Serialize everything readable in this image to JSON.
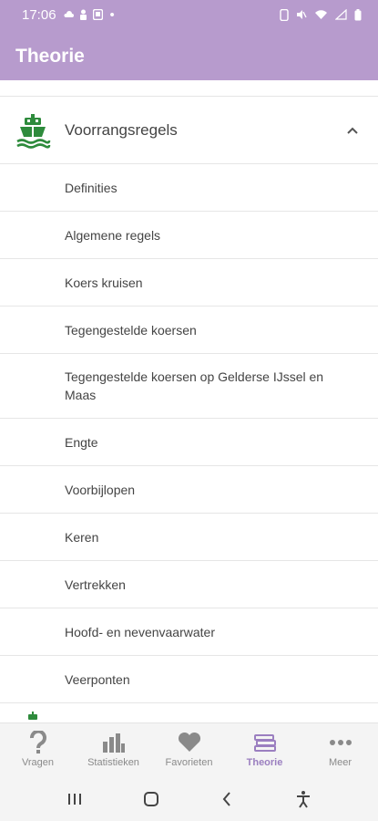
{
  "status_bar": {
    "time": "17:06",
    "dot": "•"
  },
  "header": {
    "title": "Theorie"
  },
  "section": {
    "label": "Voorrangsregels",
    "expanded": true,
    "icon": "ship-icon",
    "icon_color": "#2e8b3c"
  },
  "items": [
    "Definities",
    "Algemene regels",
    "Koers kruisen",
    "Tegengestelde koersen",
    "Tegengestelde koersen op Gelderse IJssel en Maas",
    "Engte",
    "Voorbijlopen",
    "Keren",
    "Vertrekken",
    "Hoofd- en nevenvaarwater",
    "Veerponten"
  ],
  "tabs": [
    {
      "label": "Vragen",
      "icon": "question-icon",
      "active": false
    },
    {
      "label": "Statistieken",
      "icon": "bar-chart-icon",
      "active": false
    },
    {
      "label": "Favorieten",
      "icon": "heart-icon",
      "active": false
    },
    {
      "label": "Theorie",
      "icon": "books-icon",
      "active": true
    },
    {
      "label": "Meer",
      "icon": "more-dots-icon",
      "active": false
    }
  ],
  "colors": {
    "header_bg": "#b79bcd",
    "accent": "#9b7fc0",
    "ship_green": "#2e8b3c"
  }
}
